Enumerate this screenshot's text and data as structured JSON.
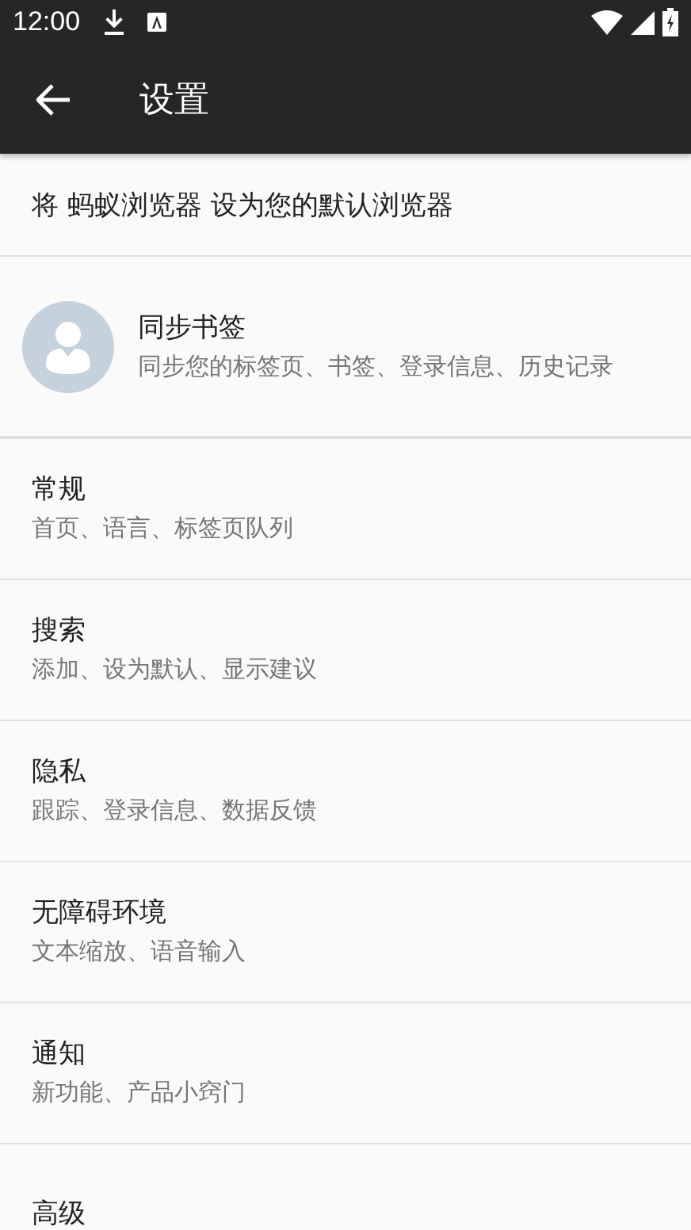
{
  "status_bar": {
    "time": "12:00"
  },
  "toolbar": {
    "title": "设置"
  },
  "default_browser_prompt": "将 蚂蚁浏览器 设为您的默认浏览器",
  "sync": {
    "title": "同步书签",
    "subtitle": "同步您的标签页、书签、登录信息、历史记录"
  },
  "settings": [
    {
      "title": "常规",
      "subtitle": "首页、语言、标签页队列"
    },
    {
      "title": "搜索",
      "subtitle": "添加、设为默认、显示建议"
    },
    {
      "title": "隐私",
      "subtitle": "跟踪、登录信息、数据反馈"
    },
    {
      "title": "无障碍环境",
      "subtitle": "文本缩放、语音输入"
    },
    {
      "title": "通知",
      "subtitle": "新功能、产品小窍门"
    },
    {
      "title": "高级"
    }
  ]
}
